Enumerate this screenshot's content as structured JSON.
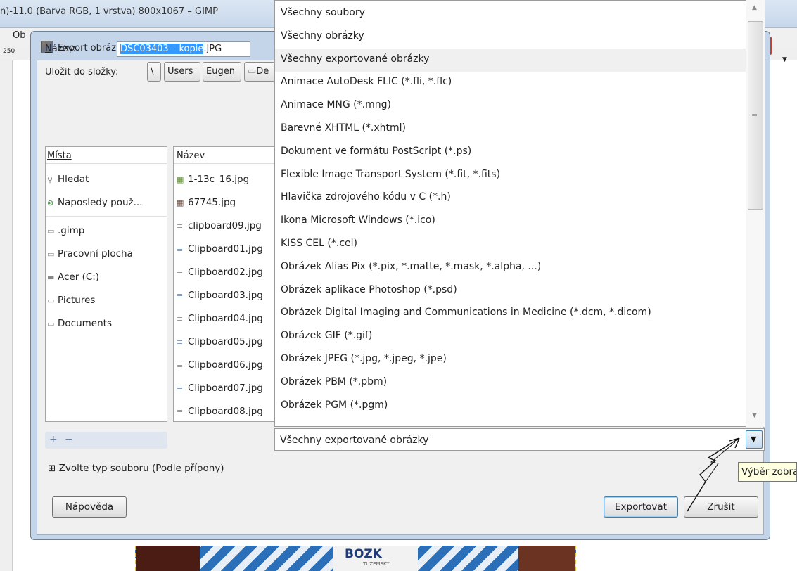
{
  "gimp": {
    "title": "n)-11.0 (Barva RGB, 1 vrstva) 800x1067 – GIMP",
    "menu_first": "Ob",
    "ruler_mark": "250",
    "shirt_text": "BOZK",
    "shirt_small": "TUZEMSKY"
  },
  "dialog": {
    "title": "Export obrázku",
    "name_label": "Název:",
    "name_value_selected": "DSC03403 – kopie",
    "name_value_rest": ".JPG",
    "folder_label": "Uložit do složky:",
    "breadcrumb": [
      "\\",
      "Users",
      "Eugen",
      "De"
    ],
    "places": {
      "header": "Místa",
      "items": [
        {
          "label": "Hledat",
          "icon": "search-icon"
        },
        {
          "label": "Naposledy použ...",
          "icon": "recent-icon"
        },
        {
          "label": ".gimp",
          "icon": "folder-icon"
        },
        {
          "label": "Pracovní plocha",
          "icon": "folder-icon"
        },
        {
          "label": "Acer (C:)",
          "icon": "drive-icon"
        },
        {
          "label": "Pictures",
          "icon": "folder-icon"
        },
        {
          "label": "Documents",
          "icon": "folder-icon"
        }
      ]
    },
    "files": {
      "header": "Název",
      "items": [
        "1-13c_16.jpg",
        "67745.jpg",
        "clipboard09.jpg",
        "Clipboard01.jpg",
        "Clipboard02.jpg",
        "Clipboard03.jpg",
        "Clipboard04.jpg",
        "Clipboard05.jpg",
        "Clipboard06.jpg",
        "Clipboard07.jpg",
        "Clipboard08.jpg"
      ]
    },
    "add_symbol": "+",
    "remove_symbol": "−",
    "file_type_expander": "⊞ Zvolte typ souboru (Podle přípony)",
    "help_button": "Nápověda",
    "export_button": "Exportovat",
    "cancel_button": "Zrušit"
  },
  "filter_dropdown": {
    "options": [
      "Všechny soubory",
      "Všechny obrázky",
      "Všechny exportované obrázky",
      "Animace AutoDesk FLIC (*.fli, *.flc)",
      "Animace MNG (*.mng)",
      "Barevné XHTML (*.xhtml)",
      "Dokument ve formátu PostScript (*.ps)",
      "Flexible Image Transport System (*.fit, *.fits)",
      "Hlavička zdrojového kódu v C (*.h)",
      "Ikona Microsoft Windows (*.ico)",
      "KISS CEL (*.cel)",
      "Obrázek Alias Pix (*.pix, *.matte, *.mask, *.alpha, ...)",
      "Obrázek aplikace Photoshop (*.psd)",
      "Obrázek Digital Imaging and Communications in Medicine (*.dcm, *.dicom)",
      "Obrázek GIF (*.gif)",
      "Obrázek JPEG (*.jpg, *.jpeg, *.jpe)",
      "Obrázek PBM (*.pbm)",
      "Obrázek PGM (*.pgm)"
    ],
    "highlighted_index": 2,
    "selected": "Všechny exportované obrázky",
    "tooltip": "Výběr zobrazení"
  }
}
